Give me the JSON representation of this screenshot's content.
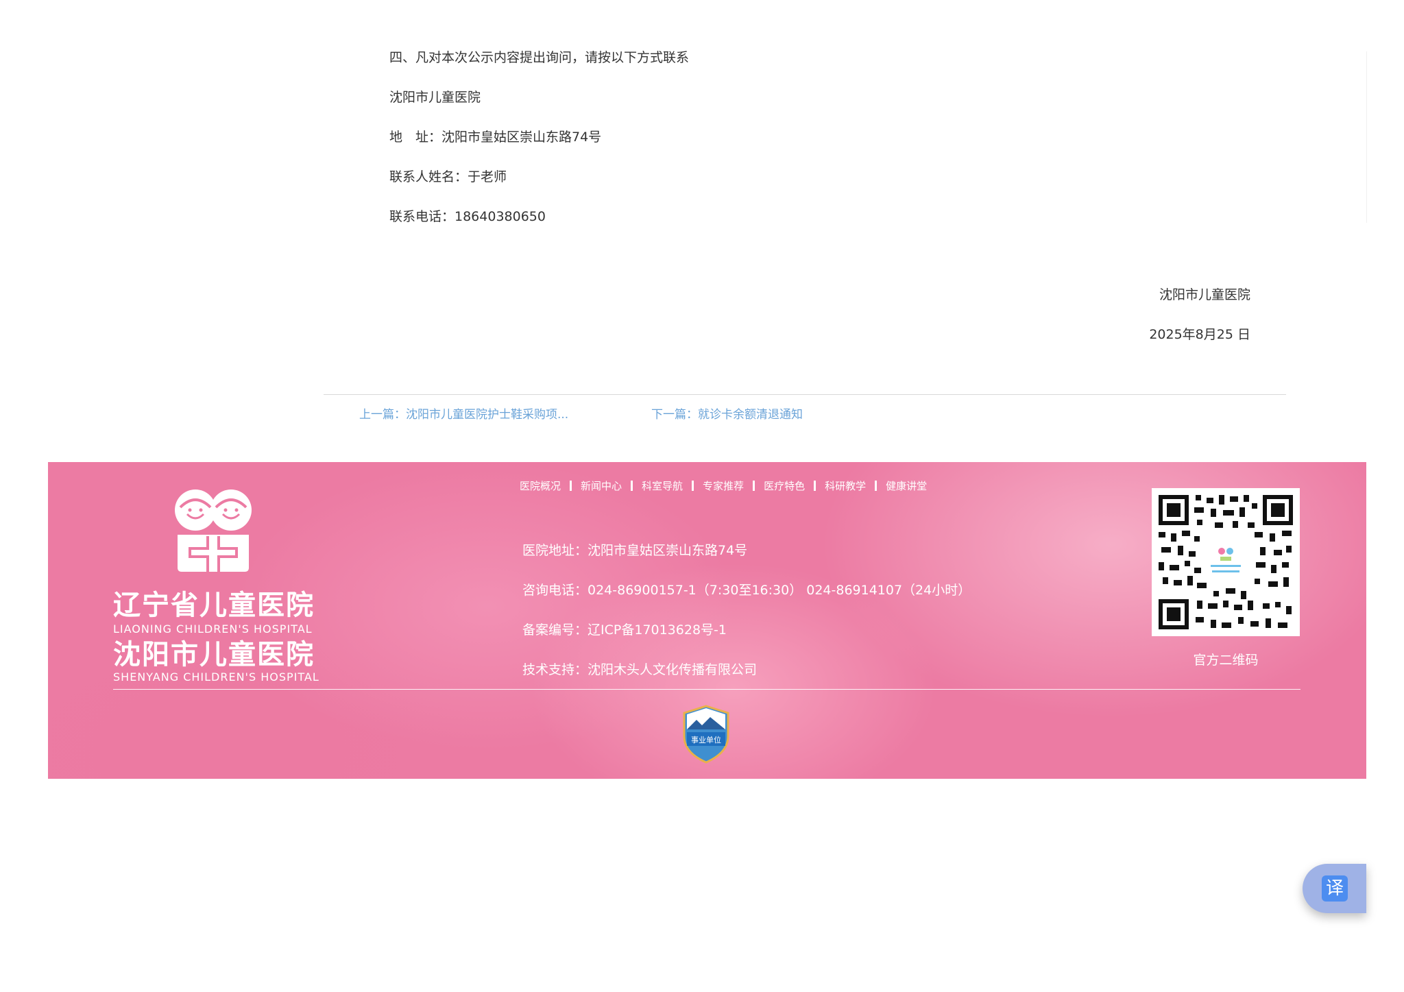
{
  "article": {
    "paragraphs": [
      "四、凡对本次公示内容提出询问，请按以下方式联系",
      "沈阳市儿童医院",
      "地　址：沈阳市皇姑区崇山东路74号",
      "联系人姓名：于老师",
      "联系电话：18640380650"
    ],
    "signature_org": "沈阳市儿童医院",
    "signature_date": "2025年8月25 日"
  },
  "navigation": {
    "prev": "上一篇：沈阳市儿童医院护士鞋采购项...",
    "next": "下一篇：就诊卡余额清退通知"
  },
  "footer": {
    "logo": {
      "cn_line1": "辽宁省儿童医院",
      "en_line1": "LIAONING CHILDREN'S HOSPITAL",
      "cn_line2": "沈阳市儿童医院",
      "en_line2": "SHENYANG CHILDREN'S HOSPITAL"
    },
    "nav": [
      "医院概况",
      "新闻中心",
      "科室导航",
      "专家推荐",
      "医疗特色",
      "科研教学",
      "健康讲堂"
    ],
    "info": {
      "address": "医院地址：沈阳市皇姑区崇山东路74号",
      "phone": "咨询电话：024-86900157-1（7:30至16:30） 024-86914107（24小时）",
      "icp": "备案编号：辽ICP备17013628号-1",
      "support": "技术支持：沈阳木头人文化传播有限公司"
    },
    "qr_label": "官方二维码",
    "badge_text": "事业单位"
  },
  "translate_button": "译",
  "colors": {
    "footer_bg": "#ec7ba3",
    "link": "#6aa3d8",
    "translate_bg": "#9fb2e6",
    "translate_icon": "#4d8df0"
  }
}
